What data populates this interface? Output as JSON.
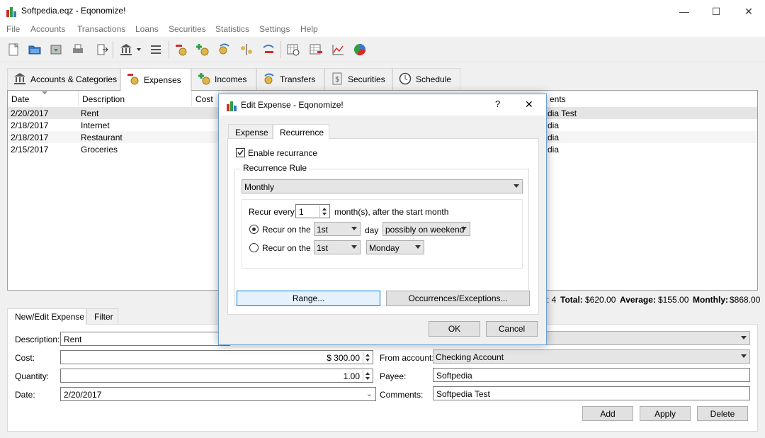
{
  "window": {
    "title": "Softpedia.eqz - Eqonomize!",
    "minimize": "—",
    "maximize": "☐",
    "close": "✕"
  },
  "menu": [
    "File",
    "Accounts",
    "Transactions",
    "Loans",
    "Securities",
    "Statistics",
    "Settings",
    "Help"
  ],
  "main_tabs": [
    "Accounts & Categories",
    "Expenses",
    "Incomes",
    "Transfers",
    "Securities",
    "Schedule"
  ],
  "table": {
    "columns": [
      "Date",
      "Description",
      "Cost",
      "ents"
    ],
    "rows": [
      {
        "date": "2/20/2017",
        "description": "Rent",
        "comments": "dia Test"
      },
      {
        "date": "2/18/2017",
        "description": "Internet",
        "comments": "dia"
      },
      {
        "date": "2/18/2017",
        "description": "Restaurant",
        "comments": "dia"
      },
      {
        "date": "2/15/2017",
        "description": "Groceries",
        "comments": "dia"
      }
    ]
  },
  "summary": {
    "count_tail": ": 4",
    "total_label": "Total:",
    "total_value": "$620.00",
    "average_label": "Average:",
    "average_value": "$155.00",
    "monthly_label": "Monthly:",
    "monthly_value": "$868.00"
  },
  "editor": {
    "tabs": [
      "New/Edit Expense",
      "Filter"
    ],
    "description_label": "Description:",
    "description_value": "Rent",
    "cost_label": "Cost:",
    "cost_value": "$ 300.00",
    "quantity_label": "Quantity:",
    "quantity_value": "1.00",
    "date_label": "Date:",
    "date_value": "2/20/2017",
    "from_account_label": "From account:",
    "from_account_value": "Checking Account",
    "payee_label": "Payee:",
    "payee_value": "Softpedia",
    "comments_label": "Comments:",
    "comments_value": "Softpedia Test",
    "add": "Add",
    "apply": "Apply",
    "delete": "Delete"
  },
  "dialog": {
    "title": "Edit Expense - Eqonomize!",
    "help": "?",
    "close": "✕",
    "tabs": [
      "Expense",
      "Recurrence"
    ],
    "enable_recurrence": "Enable recurrance",
    "rule_group": "Recurrence Rule",
    "frequency": "Monthly",
    "recur_every_label": "Recur every",
    "recur_every_value": "1",
    "recur_every_suffix": "month(s), after the start month",
    "recur_on_label_1": "Recur on the",
    "recur_on_day_1": "1st",
    "day_label": "day",
    "weekend_option": "possibly on weekend",
    "recur_on_label_2": "Recur on the",
    "recur_on_day_2": "1st",
    "weekday_option": "Monday",
    "range_button": "Range...",
    "occurrences_button": "Occurrences/Exceptions...",
    "ok": "OK",
    "cancel": "Cancel"
  },
  "colors": {
    "accent": "#0078d7",
    "dialog_border": "#6aa0d4",
    "selected_row": "#e5e5e5"
  }
}
